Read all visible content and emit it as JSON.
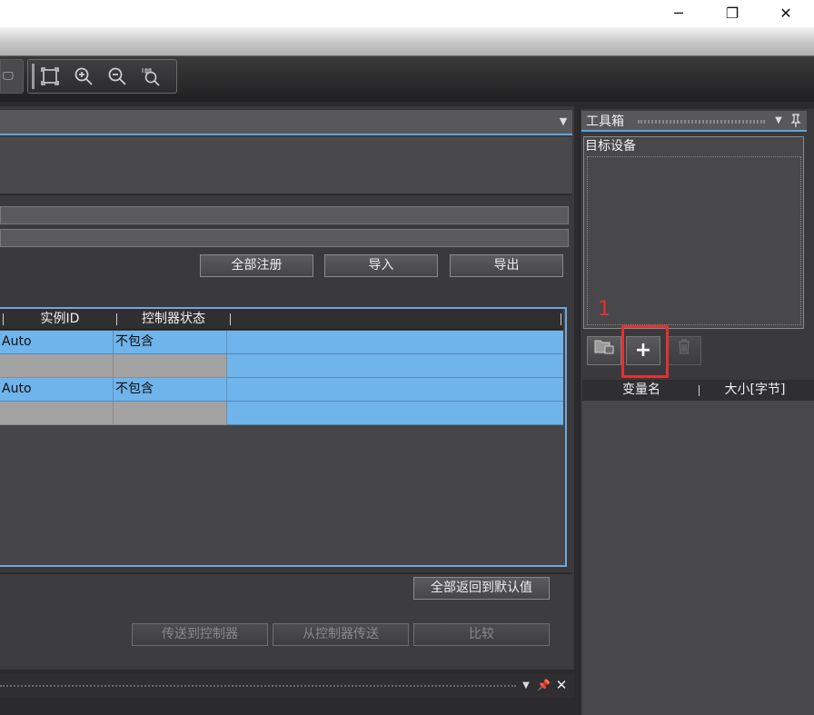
{
  "window": {
    "controls": {
      "minimize": "─",
      "restore": "❐",
      "close": "✕"
    }
  },
  "toolbar": {
    "icons": [
      "fit-window-icon",
      "zoom-in-icon",
      "zoom-out-icon",
      "zoom-100-icon"
    ]
  },
  "main": {
    "actions": {
      "register_all": "全部注册",
      "import": "导入",
      "export": "导出"
    },
    "table": {
      "columns": [
        "实例ID",
        "控制器状态"
      ],
      "rows": [
        {
          "instance_id": "Auto",
          "controller_status": "不包含",
          "style": "blue"
        },
        {
          "instance_id": "",
          "controller_status": "",
          "style": "grey"
        },
        {
          "instance_id": "Auto",
          "controller_status": "不包含",
          "style": "blue"
        },
        {
          "instance_id": "",
          "controller_status": "",
          "style": "grey"
        }
      ]
    },
    "restore_default": "全部返回到默认值",
    "transfer": {
      "to_controller": "传送到控制器",
      "from_controller": "从控制器传送",
      "compare": "比较"
    }
  },
  "toolbox": {
    "title": "工具箱",
    "target_device_label": "目标设备",
    "annotation": "1",
    "variable_columns": [
      "变量名",
      "大小[字节]"
    ]
  },
  "colors": {
    "accent": "#5da6e0",
    "row_blue": "#6fb4ea",
    "row_grey": "#a2a2a2",
    "annotation_red": "#e53030"
  }
}
